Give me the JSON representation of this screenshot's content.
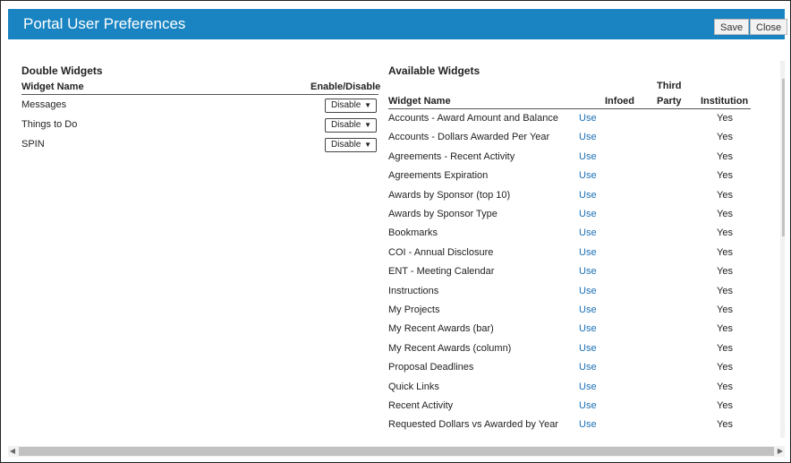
{
  "dialog": {
    "title": "Portal User Preferences",
    "save_label": "Save",
    "close_label": "Close"
  },
  "double_widgets": {
    "title": "Double Widgets",
    "col_name": "Widget Name",
    "col_enable": "Enable/Disable",
    "rows": [
      {
        "name": "Messages",
        "value": "Disable"
      },
      {
        "name": "Things to Do",
        "value": "Disable"
      },
      {
        "name": "SPIN",
        "value": "Disable"
      }
    ]
  },
  "available_widgets": {
    "title": "Available Widgets",
    "col_name": "Widget Name",
    "col_infoed": "Infoed",
    "col_third_party_1": "Third",
    "col_third_party_2": "Party",
    "col_institution": "Institution",
    "rows": [
      {
        "name": "Accounts - Award Amount and Balance",
        "use": "Use",
        "institution": "Yes"
      },
      {
        "name": "Accounts - Dollars Awarded Per Year",
        "use": "Use",
        "institution": "Yes"
      },
      {
        "name": "Agreements - Recent Activity",
        "use": "Use",
        "institution": "Yes"
      },
      {
        "name": "Agreements Expiration",
        "use": "Use",
        "institution": "Yes"
      },
      {
        "name": "Awards by Sponsor (top 10)",
        "use": "Use",
        "institution": "Yes"
      },
      {
        "name": "Awards by Sponsor Type",
        "use": "Use",
        "institution": "Yes"
      },
      {
        "name": "Bookmarks",
        "use": "Use",
        "institution": "Yes"
      },
      {
        "name": "COI - Annual Disclosure",
        "use": "Use",
        "institution": "Yes"
      },
      {
        "name": "ENT - Meeting Calendar",
        "use": "Use",
        "institution": "Yes"
      },
      {
        "name": "Instructions",
        "use": "Use",
        "institution": "Yes"
      },
      {
        "name": "My Projects",
        "use": "Use",
        "institution": "Yes"
      },
      {
        "name": "My Recent Awards (bar)",
        "use": "Use",
        "institution": "Yes"
      },
      {
        "name": "My Recent Awards (column)",
        "use": "Use",
        "institution": "Yes"
      },
      {
        "name": "Proposal Deadlines",
        "use": "Use",
        "institution": "Yes"
      },
      {
        "name": "Quick Links",
        "use": "Use",
        "institution": "Yes"
      },
      {
        "name": "Recent Activity",
        "use": "Use",
        "institution": "Yes"
      },
      {
        "name": "Requested Dollars vs Awarded by Year",
        "use": "Use",
        "institution": "Yes"
      }
    ]
  },
  "icons": {
    "dropdown": "chevron-down-icon",
    "scroll_up": "scroll-up-arrow-icon",
    "scroll_down": "scroll-down-arrow-icon",
    "scroll_left": "scroll-left-arrow-icon",
    "scroll_right": "scroll-right-arrow-icon"
  },
  "colors": {
    "title_bar": "#1a84c2",
    "link": "#1a6fb4"
  }
}
